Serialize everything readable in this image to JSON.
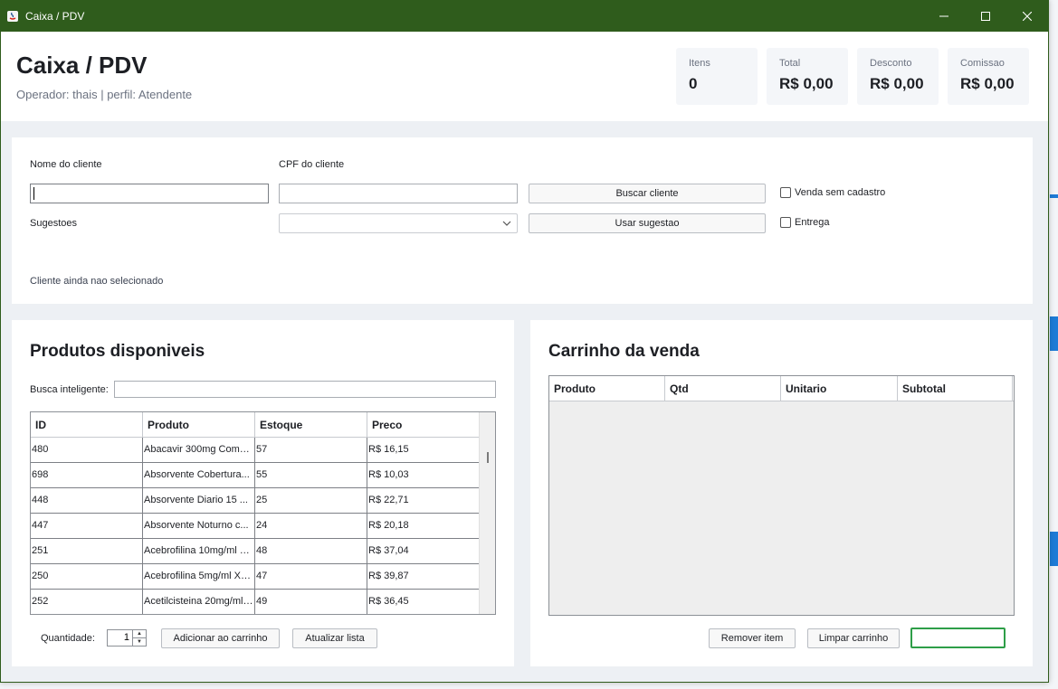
{
  "window": {
    "title": "Caixa / PDV"
  },
  "header": {
    "title": "Caixa / PDV",
    "subtitle": "Operador: thais | perfil: Atendente",
    "stats": [
      {
        "label": "Itens",
        "value": "0"
      },
      {
        "label": "Total",
        "value": "R$ 0,00"
      },
      {
        "label": "Desconto",
        "value": "R$ 0,00"
      },
      {
        "label": "Comissao",
        "value": "R$ 0,00"
      }
    ]
  },
  "customer": {
    "name_label": "Nome do cliente",
    "name_value": "",
    "cpf_label": "CPF do cliente",
    "cpf_value": "",
    "search_button": "Buscar cliente",
    "no_registration_label": "Venda sem cadastro",
    "no_registration_checked": false,
    "suggestions_label": "Sugestoes",
    "suggestion_selected": "",
    "use_suggestion_button": "Usar sugestao",
    "delivery_label": "Entrega",
    "delivery_checked": false,
    "status": "Cliente ainda nao selecionado"
  },
  "products": {
    "title": "Produtos disponiveis",
    "search_label": "Busca inteligente:",
    "search_value": "",
    "columns": [
      "ID",
      "Produto",
      "Estoque",
      "Preco"
    ],
    "rows": [
      {
        "id": "480",
        "produto": "Abacavir 300mg Comp...",
        "estoque": "57",
        "preco": "R$ 16,15"
      },
      {
        "id": "698",
        "produto": "Absorvente Cobertura...",
        "estoque": "55",
        "preco": "R$ 10,03"
      },
      {
        "id": "448",
        "produto": "Absorvente Diario 15 ...",
        "estoque": "25",
        "preco": "R$ 22,71"
      },
      {
        "id": "447",
        "produto": "Absorvente Noturno c...",
        "estoque": "24",
        "preco": "R$ 20,18"
      },
      {
        "id": "251",
        "produto": "Acebrofilina 10mg/ml X...",
        "estoque": "48",
        "preco": "R$ 37,04"
      },
      {
        "id": "250",
        "produto": "Acebrofilina 5mg/ml Xa...",
        "estoque": "47",
        "preco": "R$ 39,87"
      },
      {
        "id": "252",
        "produto": "Acetilcisteina 20mg/ml ...",
        "estoque": "49",
        "preco": "R$ 36,45"
      }
    ],
    "quantity_label": "Quantidade:",
    "quantity_value": "1",
    "add_button": "Adicionar ao carrinho",
    "refresh_button": "Atualizar lista"
  },
  "cart": {
    "title": "Carrinho da venda",
    "columns": [
      "Produto",
      "Qtd",
      "Unitario",
      "Subtotal"
    ],
    "remove_button": "Remover item",
    "clear_button": "Limpar carrinho",
    "finalize_button": ""
  },
  "colors": {
    "titlebar": "#2f5c1c",
    "page_bg": "#edf0f4",
    "focus_border": "#2e9e48"
  }
}
